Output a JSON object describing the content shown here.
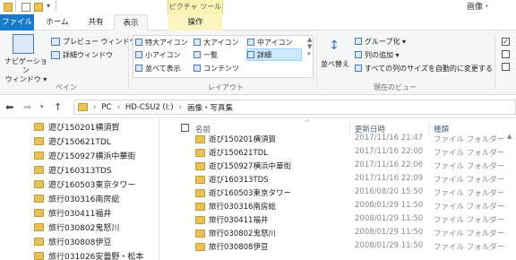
{
  "window": {
    "title": "画像・",
    "tools_tab": "ピクチャ ツール"
  },
  "ribbon_tabs": [
    {
      "label": "ファイル"
    },
    {
      "label": "ホーム"
    },
    {
      "label": "共有"
    },
    {
      "label": "表示"
    },
    {
      "label": "操作"
    }
  ],
  "ribbon": {
    "pane": {
      "nav_pane": "ナビゲーション\nウィンドウ ▾",
      "preview": "プレビュー ウィンドウ",
      "details": "詳細ウィンドウ",
      "group_label": "ペイン"
    },
    "layout": {
      "extra_large": "特大アイコン",
      "large": "大アイコン",
      "medium": "中アイコン",
      "small": "小アイコン",
      "list": "一覧",
      "details": "詳細",
      "tiles": "並べて表示",
      "content": "コンテンツ",
      "group_label": "レイアウト"
    },
    "current_view": {
      "sort": "並べ替え",
      "group_by": "グループ化 ▾",
      "add_column": "列の追加 ▾",
      "fit_columns": "すべての列のサイズを自動的に変更する",
      "group_label": "現在のビュー"
    }
  },
  "address": {
    "crumbs": [
      "PC",
      "HD-CSU2 (I:)",
      "画像・写真集"
    ]
  },
  "nav_pane_items": [
    "遊び150201横須賀",
    "遊び150621TDL",
    "遊び150927横浜中華街",
    "遊び160313TDS",
    "遊び160503東京タワー",
    "旅行030316南房総",
    "旅行030411福井",
    "旅行030802鬼怒川",
    "旅行030808伊豆",
    "旅行031026安曇野・松本"
  ],
  "columns": {
    "name": "名前",
    "date": "更新日時",
    "type": "種類"
  },
  "files": [
    {
      "name": "遊び150201横須賀",
      "date": "2017/11/16 21:47",
      "type": "ファイル フォルダー"
    },
    {
      "name": "遊び150621TDL",
      "date": "2017/11/16 22:00",
      "type": "ファイル フォルダー"
    },
    {
      "name": "遊び150927横浜中華街",
      "date": "2017/11/16 22:06",
      "type": "ファイル フォルダー"
    },
    {
      "name": "遊び160313TDS",
      "date": "2017/11/16 22:09",
      "type": "ファイル フォルダー"
    },
    {
      "name": "遊び160503東京タワー",
      "date": "2016/08/20 15:50",
      "type": "ファイル フォルダー"
    },
    {
      "name": "旅行030316南房総",
      "date": "2008/01/29 11:50",
      "type": "ファイル フォルダー"
    },
    {
      "name": "旅行030411福井",
      "date": "2008/01/29 11:50",
      "type": "ファイル フォルダー"
    },
    {
      "name": "旅行030802鬼怒川",
      "date": "2008/01/29 11:50",
      "type": "ファイル フォルダー"
    },
    {
      "name": "旅行030808伊豆",
      "date": "2008/01/29 11:50",
      "type": "ファイル フォルダー"
    }
  ],
  "colors": {
    "file_tab": "#1979ca",
    "selected": "#cde8ff",
    "folder": "#e8c15a",
    "tools_tab": "#faf4b4"
  }
}
